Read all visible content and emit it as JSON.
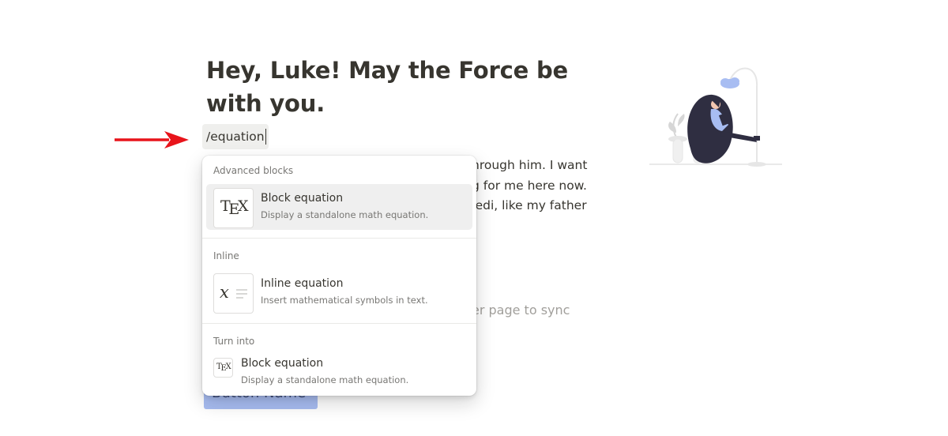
{
  "page": {
    "title": "Hey, Luke! May the Force be with you."
  },
  "editor": {
    "slash_command": "/equation",
    "paragraph_lines": [
      "hrough him. I want",
      "g for me here now.",
      "Jedi, like my father"
    ],
    "synced_hint": "er page to sync",
    "button_label": "Button Name"
  },
  "menu": {
    "sections": [
      {
        "label": "Advanced blocks",
        "items": [
          {
            "title": "Block equation",
            "description": "Display a standalone math equation.",
            "icon": "tex-icon"
          }
        ]
      },
      {
        "label": "Inline",
        "items": [
          {
            "title": "Inline equation",
            "description": "Insert mathematical symbols in text.",
            "icon": "math-x-icon"
          }
        ]
      },
      {
        "label": "Turn into",
        "items": [
          {
            "title": "Block equation",
            "description": "Display a standalone math equation.",
            "icon": "tex-icon"
          }
        ]
      }
    ]
  },
  "colors": {
    "annotation_arrow": "#e8141b",
    "button_background": "#a8bdf2",
    "illustration_primary": "#2f2e41",
    "illustration_accent": "#a8bdf2"
  }
}
